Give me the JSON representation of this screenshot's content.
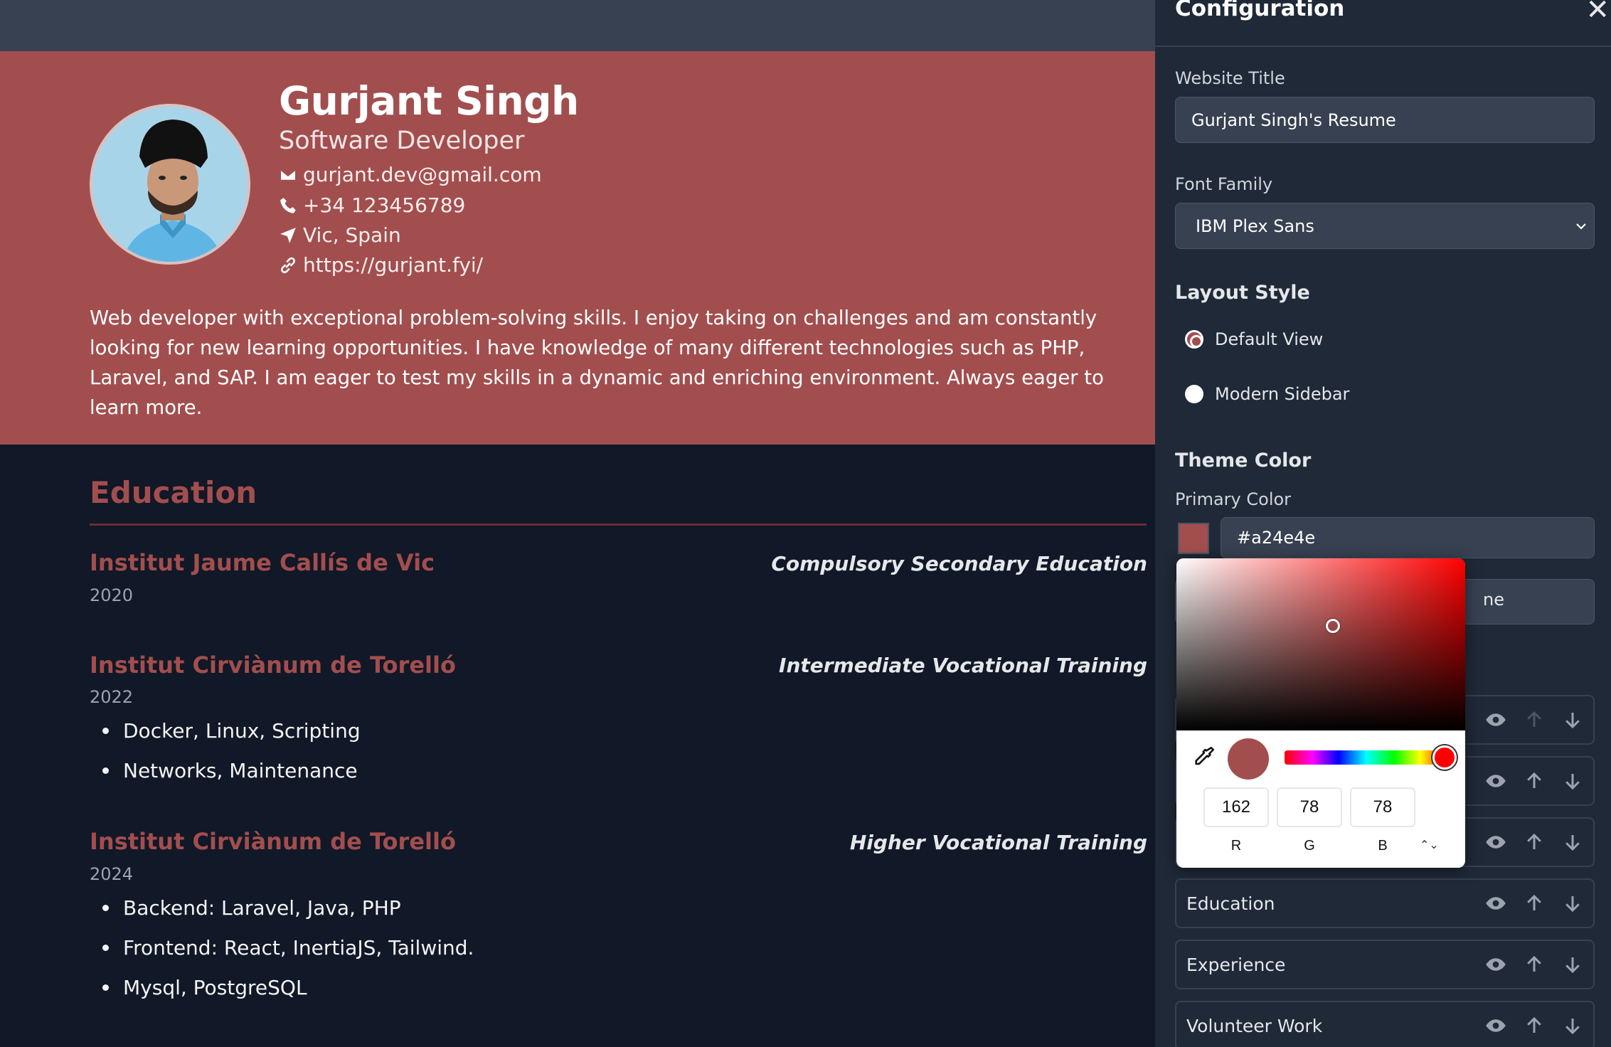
{
  "resume": {
    "name": "Gurjant Singh",
    "role": "Software Developer",
    "email": "gurjant.dev@gmail.com",
    "phone": "+34 123456789",
    "location": "Vic, Spain",
    "website": "https://gurjant.fyi/",
    "summary": "Web developer with exceptional problem-solving skills. I enjoy taking on challenges and am constantly looking for new learning opportunities. I have knowledge of many different technologies such as PHP, Laravel, and SAP. I am eager to test my skills in a dynamic and enriching environment. Always eager to learn more.",
    "education_title": "Education",
    "education": [
      {
        "school": "Institut Jaume Callís de Vic",
        "degree": "Compulsory Secondary Education",
        "year": "2020",
        "items": []
      },
      {
        "school": "Institut Cirviànum de Torelló",
        "degree": "Intermediate Vocational Training",
        "year": "2022",
        "items": [
          "Docker, Linux, Scripting",
          "Networks, Maintenance"
        ]
      },
      {
        "school": "Institut Cirviànum de Torelló",
        "degree": "Higher Vocational Training",
        "year": "2024",
        "items": [
          "Backend: Laravel, Java, PHP",
          "Frontend: React, InertiaJS, Tailwind.",
          "Mysql, PostgreSQL"
        ]
      }
    ]
  },
  "config": {
    "title": "Configuration",
    "close_icon": "close-icon",
    "website_title_label": "Website Title",
    "website_title_value": "Gurjant Singh's Resume",
    "font_family_label": "Font Family",
    "font_family_value": "IBM Plex Sans",
    "layout_style_label": "Layout Style",
    "layout_options": [
      {
        "label": "Default View",
        "checked": true
      },
      {
        "label": "Modern Sidebar",
        "checked": false
      }
    ],
    "theme_color_label": "Theme Color",
    "primary_color_label": "Primary Color",
    "primary_color_value": "#a24e4e",
    "partial_field_text": "ne",
    "sections": [
      "Education",
      "Experience",
      "Volunteer Work"
    ]
  },
  "picker": {
    "r": "162",
    "g": "78",
    "b": "78",
    "r_label": "R",
    "g_label": "G",
    "b_label": "B",
    "toggle": "⌃⌄"
  },
  "colors": {
    "primary": "#a24e4e",
    "background": "#111827",
    "panel": "#1f2937"
  }
}
